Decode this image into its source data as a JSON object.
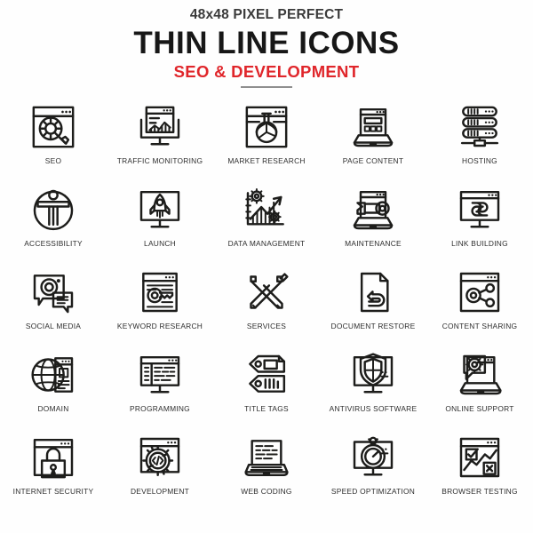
{
  "header": {
    "kicker": "48x48 PIXEL PERFECT",
    "title": "THIN LINE ICONS",
    "subtitle": "SEO & DEVELOPMENT",
    "accent_color": "#E0262B",
    "title_color": "#171717",
    "kicker_color": "#3b3b3b",
    "rule_color": "#8f8f8f"
  },
  "grid": {
    "columns": 5,
    "rows": 5,
    "stroke_color": "#1d1d1b",
    "background_color": "#fefefe",
    "label_color": "#2e2e2e",
    "items": [
      {
        "label": "SEO",
        "icon": "browser-magnifier-gear-icon"
      },
      {
        "label": "TRAFFIC MONITORING",
        "icon": "monitor-bar-chart-icon"
      },
      {
        "label": "MARKET RESEARCH",
        "icon": "browser-flask-pie-icon"
      },
      {
        "label": "PAGE CONTENT",
        "icon": "laptop-layout-blocks-icon"
      },
      {
        "label": "HOSTING",
        "icon": "server-stack-icon"
      },
      {
        "label": "ACCESSIBILITY",
        "icon": "accessibility-person-circle-icon"
      },
      {
        "label": "LAUNCH",
        "icon": "monitor-rocket-icon"
      },
      {
        "label": "DATA MANAGEMENT",
        "icon": "growth-chart-gears-icon"
      },
      {
        "label": "MAINTENANCE",
        "icon": "laptop-wrench-icon"
      },
      {
        "label": "LINK BUILDING",
        "icon": "monitor-chain-link-icon"
      },
      {
        "label": "SOCIAL MEDIA",
        "icon": "chat-bubble-camera-icon"
      },
      {
        "label": "KEYWORD RESEARCH",
        "icon": "browser-key-icon"
      },
      {
        "label": "SERVICES",
        "icon": "wrench-pencil-cross-icon"
      },
      {
        "label": "DOCUMENT RESTORE",
        "icon": "document-undo-arrow-icon"
      },
      {
        "label": "CONTENT SHARING",
        "icon": "browser-share-network-icon"
      },
      {
        "label": "DOMAIN",
        "icon": "globe-document-icon"
      },
      {
        "label": "PROGRAMMING",
        "icon": "monitor-code-lines-icon"
      },
      {
        "label": "TITLE TAGS",
        "icon": "двух-tags-icon"
      },
      {
        "label": "ANTIVIRUS SOFTWARE",
        "icon": "monitor-shield-icon"
      },
      {
        "label": "ONLINE SUPPORT",
        "icon": "laptop-gear-chat-icon"
      },
      {
        "label": "INTERNET SECURITY",
        "icon": "browser-padlock-icon"
      },
      {
        "label": "DEVELOPMENT",
        "icon": "browser-gear-code-icon"
      },
      {
        "label": "WEB CODING",
        "icon": "laptop-code-icon"
      },
      {
        "label": "SPEED OPTIMIZATION",
        "icon": "monitor-stopwatch-icon"
      },
      {
        "label": "BROWSER TESTING",
        "icon": "browser-check-cross-chart-icon"
      }
    ]
  }
}
